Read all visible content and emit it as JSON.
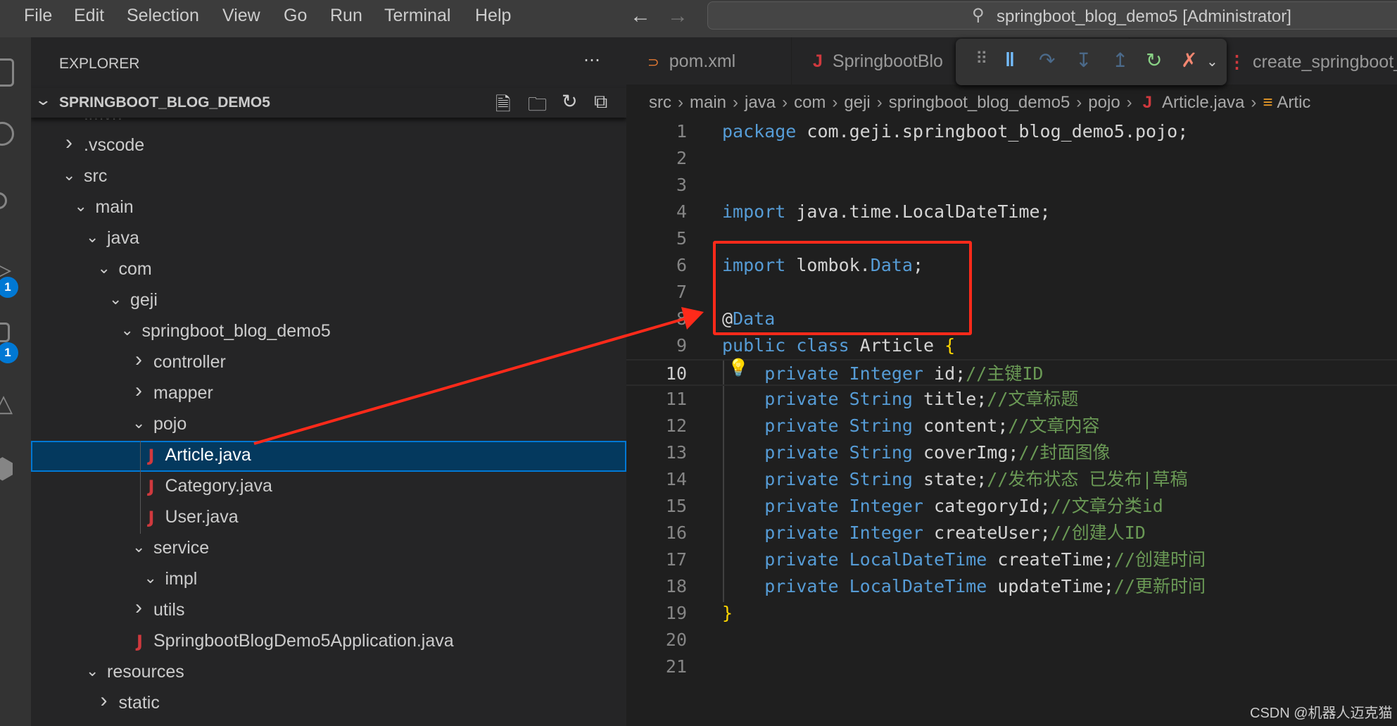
{
  "menubar": {
    "items": [
      "File",
      "Edit",
      "Selection",
      "View",
      "Go",
      "Run",
      "Terminal",
      "Help"
    ],
    "command_center": "springboot_blog_demo5 [Administrator]"
  },
  "activity": {
    "run_badge": "1",
    "extensions_badge": "1"
  },
  "explorer": {
    "title": "EXPLORER",
    "project": "SPRINGBOOT_BLOG_DEMO5",
    "tree": [
      {
        "label": ".mvn",
        "depth": 0,
        "kind": "folder",
        "open": false
      },
      {
        "label": ".vscode",
        "depth": 0,
        "kind": "folder",
        "open": false
      },
      {
        "label": "src",
        "depth": 0,
        "kind": "folder",
        "open": true
      },
      {
        "label": "main",
        "depth": 1,
        "kind": "folder",
        "open": true
      },
      {
        "label": "java",
        "depth": 2,
        "kind": "folder",
        "open": true
      },
      {
        "label": "com",
        "depth": 3,
        "kind": "folder",
        "open": true
      },
      {
        "label": "geji",
        "depth": 4,
        "kind": "folder",
        "open": true
      },
      {
        "label": "springboot_blog_demo5",
        "depth": 5,
        "kind": "folder",
        "open": true
      },
      {
        "label": "controller",
        "depth": 6,
        "kind": "folder",
        "open": false
      },
      {
        "label": "mapper",
        "depth": 6,
        "kind": "folder",
        "open": false
      },
      {
        "label": "pojo",
        "depth": 6,
        "kind": "folder",
        "open": true
      },
      {
        "label": "Article.java",
        "depth": 7,
        "kind": "java",
        "selected": true
      },
      {
        "label": "Category.java",
        "depth": 7,
        "kind": "java"
      },
      {
        "label": "User.java",
        "depth": 7,
        "kind": "java"
      },
      {
        "label": "service",
        "depth": 6,
        "kind": "folder",
        "open": true
      },
      {
        "label": "impl",
        "depth": 7,
        "kind": "folder",
        "open": true
      },
      {
        "label": "utils",
        "depth": 6,
        "kind": "folder",
        "open": false
      },
      {
        "label": "SpringbootBlogDemo5Application.java",
        "depth": 6,
        "kind": "java"
      },
      {
        "label": "resources",
        "depth": 2,
        "kind": "folder",
        "open": true
      },
      {
        "label": "static",
        "depth": 3,
        "kind": "folder",
        "open": false
      }
    ]
  },
  "tabs": [
    {
      "label": "pom.xml",
      "icon": "rss-icon"
    },
    {
      "label": "SpringbootBlo",
      "icon": "java-icon"
    },
    {
      "label": "create_springboot_b",
      "icon": "markdown-icon"
    }
  ],
  "breadcrumb": [
    "src",
    "main",
    "java",
    "com",
    "geji",
    "springboot_blog_demo5",
    "pojo",
    "Article.java",
    "Artic"
  ],
  "editor": {
    "current_line": 10,
    "lines": [
      [
        [
          "package",
          "kw"
        ],
        [
          " com.geji.springboot_blog_demo5.pojo;",
          "tx"
        ]
      ],
      [],
      [],
      [
        [
          "import",
          "kw"
        ],
        [
          " java.time.LocalDateTime;",
          "tx"
        ]
      ],
      [],
      [
        [
          "import",
          "kw"
        ],
        [
          " lombok.",
          "tx"
        ],
        [
          "Data",
          "ty"
        ],
        [
          ";",
          "tx"
        ]
      ],
      [],
      [
        [
          "@",
          "tx"
        ],
        [
          "Data",
          "ty"
        ]
      ],
      [
        [
          "public class",
          "kw"
        ],
        [
          " Article ",
          "tx"
        ],
        [
          "{",
          "br"
        ]
      ],
      [
        [
          "    private",
          "kw"
        ],
        [
          " Integer",
          "ty"
        ],
        [
          " id;",
          "tx"
        ],
        [
          "//主键ID",
          "cm"
        ]
      ],
      [
        [
          "    private",
          "kw"
        ],
        [
          " String",
          "ty"
        ],
        [
          " title;",
          "tx"
        ],
        [
          "//文章标题",
          "cm"
        ]
      ],
      [
        [
          "    private",
          "kw"
        ],
        [
          " String",
          "ty"
        ],
        [
          " content;",
          "tx"
        ],
        [
          "//文章内容",
          "cm"
        ]
      ],
      [
        [
          "    private",
          "kw"
        ],
        [
          " String",
          "ty"
        ],
        [
          " coverImg;",
          "tx"
        ],
        [
          "//封面图像",
          "cm"
        ]
      ],
      [
        [
          "    private",
          "kw"
        ],
        [
          " String",
          "ty"
        ],
        [
          " state;",
          "tx"
        ],
        [
          "//发布状态 已发布|草稿",
          "cm"
        ]
      ],
      [
        [
          "    private",
          "kw"
        ],
        [
          " Integer",
          "ty"
        ],
        [
          " categoryId;",
          "tx"
        ],
        [
          "//文章分类id",
          "cm"
        ]
      ],
      [
        [
          "    private",
          "kw"
        ],
        [
          " Integer",
          "ty"
        ],
        [
          " createUser;",
          "tx"
        ],
        [
          "//创建人ID",
          "cm"
        ]
      ],
      [
        [
          "    private",
          "kw"
        ],
        [
          " LocalDateTime",
          "ty"
        ],
        [
          " createTime;",
          "tx"
        ],
        [
          "//创建时间",
          "cm"
        ]
      ],
      [
        [
          "    private",
          "kw"
        ],
        [
          " LocalDateTime",
          "ty"
        ],
        [
          " updateTime;",
          "tx"
        ],
        [
          "//更新时间",
          "cm"
        ]
      ],
      [
        [
          "}",
          "br"
        ]
      ],
      [],
      []
    ]
  },
  "annotation_color": "#ff2a1a",
  "watermark": "CSDN @机器人迈克猫"
}
